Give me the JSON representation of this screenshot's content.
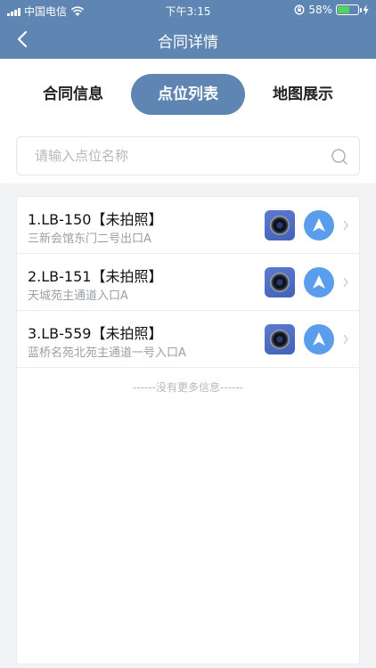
{
  "status_bar": {
    "carrier": "中国电信",
    "time": "下午3:15",
    "battery_percent": "58%",
    "battery_level": 58
  },
  "nav": {
    "title": "合同详情"
  },
  "tabs": [
    {
      "label": "合同信息",
      "active": false
    },
    {
      "label": "点位列表",
      "active": true
    },
    {
      "label": "地图展示",
      "active": false
    }
  ],
  "search": {
    "placeholder": "请输入点位名称"
  },
  "points": [
    {
      "title": "1.LB-150【未拍照】",
      "address": "三新会馆东门二号出口A"
    },
    {
      "title": "2.LB-151【未拍照】",
      "address": "天城苑主通道入口A"
    },
    {
      "title": "3.LB-559【未拍照】",
      "address": "蓝桥名苑北苑主通道一号入口A"
    }
  ],
  "list_footer": "------没有更多信息------",
  "colors": {
    "primary": "#5f86b3",
    "nav_button": "#5a9ded",
    "camera_button": "#4f6cc4"
  }
}
